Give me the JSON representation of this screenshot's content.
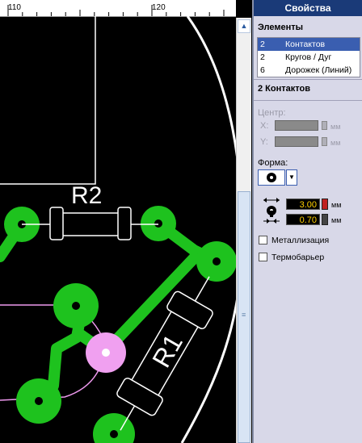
{
  "ruler": {
    "marks": [
      "110",
      "120"
    ]
  },
  "pcb": {
    "labels": {
      "r2": "R2",
      "r1": "R1"
    }
  },
  "panel": {
    "title": "Свойства",
    "elements_title": "Элементы",
    "elements": [
      {
        "count": "2",
        "name": "Контактов",
        "selected": true
      },
      {
        "count": "2",
        "name": "Кругов / Дуг",
        "selected": false
      },
      {
        "count": "6",
        "name": "Дорожек (Линий)",
        "selected": false
      }
    ],
    "selection_title": "2 Контактов",
    "center_label": "Центр:",
    "x_label": "X:",
    "y_label": "Y:",
    "unit_mm": "мм",
    "shape_label": "Форма:",
    "outer_diameter": "3.00",
    "hole_diameter": "0.70",
    "plating_label": "Металлизация",
    "thermal_label": "Термобарьер"
  }
}
